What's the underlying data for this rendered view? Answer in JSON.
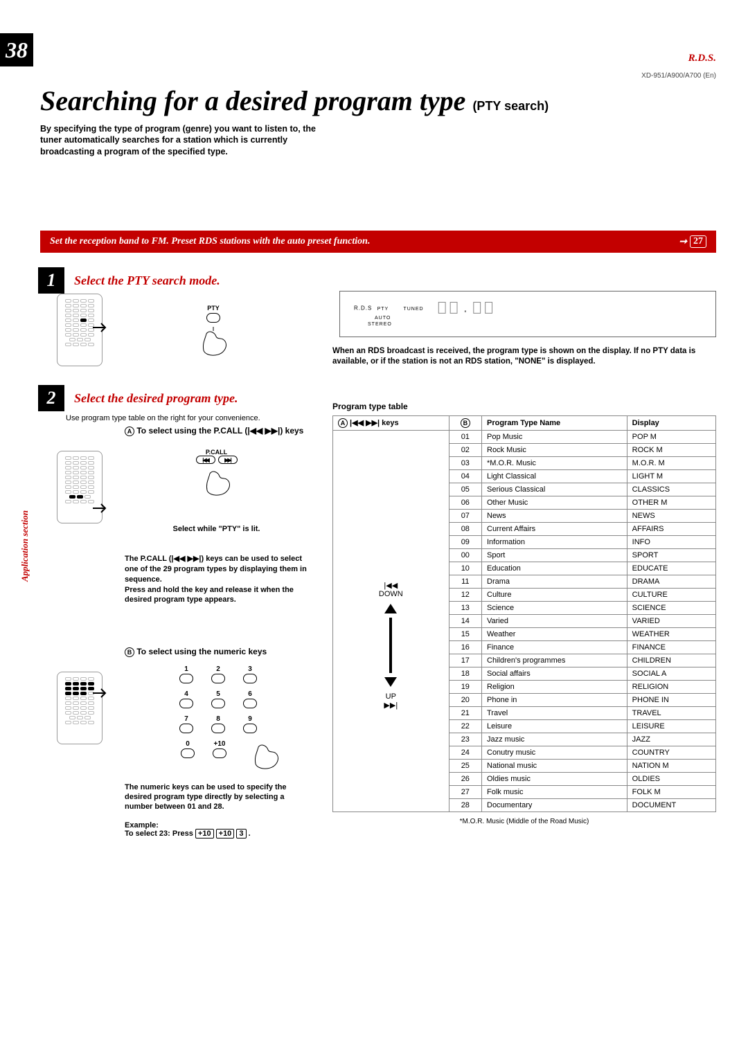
{
  "page_number": "38",
  "rds_label": "R.D.S.",
  "models": "XD-951/A900/A700 (En)",
  "title_main": "Searching for a desired program type ",
  "title_sub": "(PTY search)",
  "intro": "By specifying the type of program (genre) you want to listen to, the tuner automatically searches for a station which is currently broadcasting a program of the specified type.",
  "redbar": "Set the reception band to FM. Preset RDS stations with the auto preset function.",
  "page_ref": "27",
  "step1_number": "1",
  "step1_title": "Select the PTY search mode.",
  "pty_label": "PTY",
  "pcall_label": "P.CALL",
  "display": {
    "l1a": "R.D.S",
    "pty": "PTY",
    "tuned": "TUNED",
    "auto": "AUTO",
    "stereo": "STEREO",
    "segments": "88.88"
  },
  "display_note": "When an RDS broadcast is received, the program type is shown on the display. If no PTY data is available, or if the station is not an RDS station, \"NONE\" is displayed.",
  "step2_number": "2",
  "step2_title": "Select the desired program type.",
  "step2_note": "Use program type table on the right for your convenience.",
  "subA_circle": "A",
  "subA_title": "To select using the P.CALL (|◀◀ ▶▶|) keys",
  "subA_select": "Select while \"PTY\" is lit.",
  "subA_par1": "The P.CALL (|◀◀ ▶▶|) keys can be used to select one of the 29 program types by displaying them in sequence.",
  "subA_par2": "Press and hold the key and release it when the desired program type appears.",
  "subB_circle": "B",
  "subB_title": "To select using the numeric keys",
  "keypad_labels": [
    "1",
    "2",
    "3",
    "4",
    "5",
    "6",
    "7",
    "8",
    "9",
    "0",
    "+10"
  ],
  "num_par": "The numeric keys can be used to specify the desired program type directly by selecting a number between 01 and 28.",
  "example_label": "Example:",
  "example_text_a": "To select 23: Press ",
  "example_k1": "+10",
  "example_k2": "+10",
  "example_k3": "3",
  "example_period": ".",
  "side_label": "Application section",
  "table_caption": "Program type table",
  "th_a": "A",
  "th_a2": " |◀◀ ▶▶| keys",
  "th_b": "B",
  "th_name": "Program Type Name",
  "th_disp": "Display",
  "keycol_down": "|◀◀\nDOWN",
  "keycol_up": "UP\n▶▶|",
  "rows": [
    {
      "n": "01",
      "name": "Pop Music",
      "disp": "POP M"
    },
    {
      "n": "02",
      "name": "Rock Music",
      "disp": "ROCK M"
    },
    {
      "n": "03",
      "name": "*M.O.R. Music",
      "disp": "M.O.R. M"
    },
    {
      "n": "04",
      "name": "Light Classical",
      "disp": "LIGHT M"
    },
    {
      "n": "05",
      "name": "Serious Classical",
      "disp": "CLASSICS"
    },
    {
      "n": "06",
      "name": "Other Music",
      "disp": "OTHER M"
    },
    {
      "n": "07",
      "name": "News",
      "disp": "NEWS"
    },
    {
      "n": "08",
      "name": "Current Affairs",
      "disp": "AFFAIRS"
    },
    {
      "n": "09",
      "name": "Information",
      "disp": "INFO"
    },
    {
      "n": "00",
      "name": "Sport",
      "disp": "SPORT"
    },
    {
      "n": "10",
      "name": "Education",
      "disp": "EDUCATE"
    },
    {
      "n": "11",
      "name": "Drama",
      "disp": "DRAMA"
    },
    {
      "n": "12",
      "name": "Culture",
      "disp": "CULTURE"
    },
    {
      "n": "13",
      "name": "Science",
      "disp": "SCIENCE"
    },
    {
      "n": "14",
      "name": "Varied",
      "disp": "VARIED"
    },
    {
      "n": "15",
      "name": "Weather",
      "disp": "WEATHER"
    },
    {
      "n": "16",
      "name": "Finance",
      "disp": "FINANCE"
    },
    {
      "n": "17",
      "name": "Children's programmes",
      "disp": "CHILDREN"
    },
    {
      "n": "18",
      "name": "Social affairs",
      "disp": "SOCIAL A"
    },
    {
      "n": "19",
      "name": "Religion",
      "disp": "RELIGION"
    },
    {
      "n": "20",
      "name": "Phone in",
      "disp": "PHONE IN"
    },
    {
      "n": "21",
      "name": "Travel",
      "disp": "TRAVEL"
    },
    {
      "n": "22",
      "name": "Leisure",
      "disp": "LEISURE"
    },
    {
      "n": "23",
      "name": "Jazz music",
      "disp": "JAZZ"
    },
    {
      "n": "24",
      "name": "Conutry music",
      "disp": "COUNTRY"
    },
    {
      "n": "25",
      "name": "National music",
      "disp": "NATION M"
    },
    {
      "n": "26",
      "name": "Oldies music",
      "disp": "OLDIES"
    },
    {
      "n": "27",
      "name": "Folk music",
      "disp": "FOLK M"
    },
    {
      "n": "28",
      "name": "Documentary",
      "disp": "DOCUMENT"
    }
  ],
  "foot": "*M.O.R. Music (Middle of the Road Music)"
}
